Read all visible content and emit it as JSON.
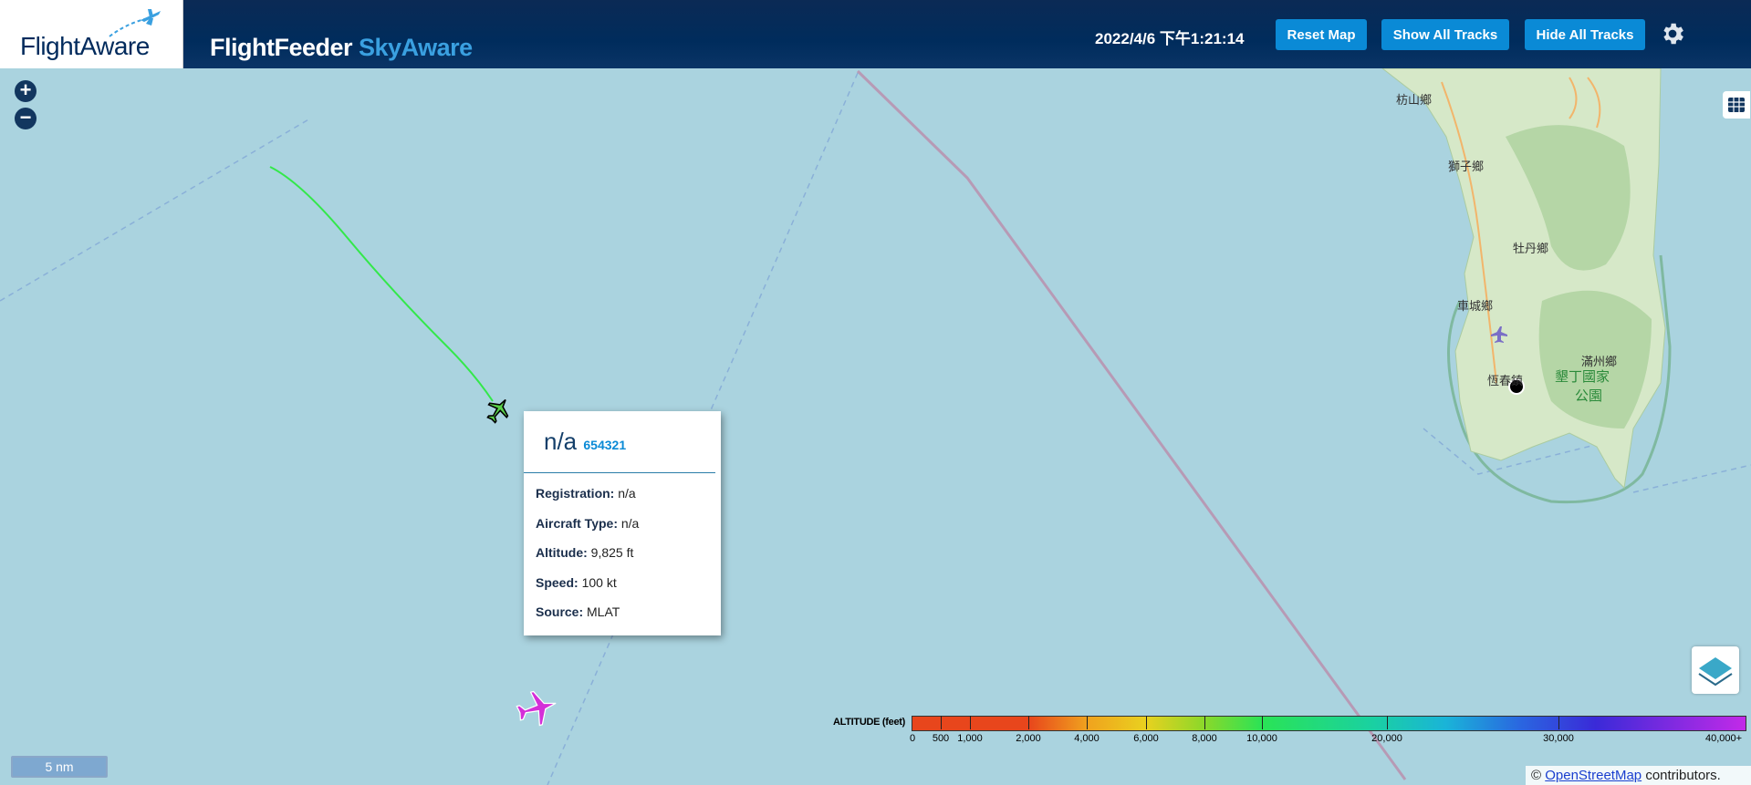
{
  "header": {
    "logo_text": "FlightAware",
    "title_main": "FlightFeeder",
    "title_accent": "SkyAware",
    "clock": "2022/4/6 下午1:21:14",
    "buttons": {
      "reset_map": "Reset Map",
      "show_all_tracks": "Show All Tracks",
      "hide_all_tracks": "Hide All Tracks"
    },
    "settings_icon": "gear-icon"
  },
  "map_controls": {
    "zoom_in": "+",
    "zoom_out": "−",
    "scale_label": "5 nm",
    "grid_icon": "grid-icon",
    "layers_icon": "layers-icon"
  },
  "map_labels": {
    "towns": [
      "枋山鄉",
      "獅子鄉",
      "牡丹鄉",
      "車城鄉",
      "滿州鄉",
      "恆春鎮"
    ],
    "park": [
      "墾丁國家",
      "公園"
    ]
  },
  "aircraft": [
    {
      "icon": "airplane-icon",
      "color": "#5ad04a",
      "selected": true
    },
    {
      "icon": "airplane-icon",
      "color": "#d42ed8",
      "selected": false
    }
  ],
  "popup": {
    "callsign": "n/a",
    "hex": "654321",
    "rows": [
      {
        "label": "Registration:",
        "value": "n/a"
      },
      {
        "label": "Aircraft Type:",
        "value": "n/a"
      },
      {
        "label": "Altitude:",
        "value": "9,825 ft"
      },
      {
        "label": "Speed:",
        "value": "100 kt"
      },
      {
        "label": "Source:",
        "value": "MLAT"
      }
    ]
  },
  "legend": {
    "title": "ALTITUDE (feet)",
    "labels": [
      "0",
      "500",
      "1,000",
      "2,000",
      "4,000",
      "6,000",
      "8,000",
      "10,000",
      "20,000",
      "30,000",
      "40,000+"
    ]
  },
  "attribution": {
    "prefix": "©",
    "link": "OpenStreetMap",
    "suffix": "contributors."
  },
  "colors": {
    "header_bg": "#002c5c",
    "button_bg": "#0a8ad6",
    "sea": "#aad3df",
    "track": "#33e84a"
  }
}
